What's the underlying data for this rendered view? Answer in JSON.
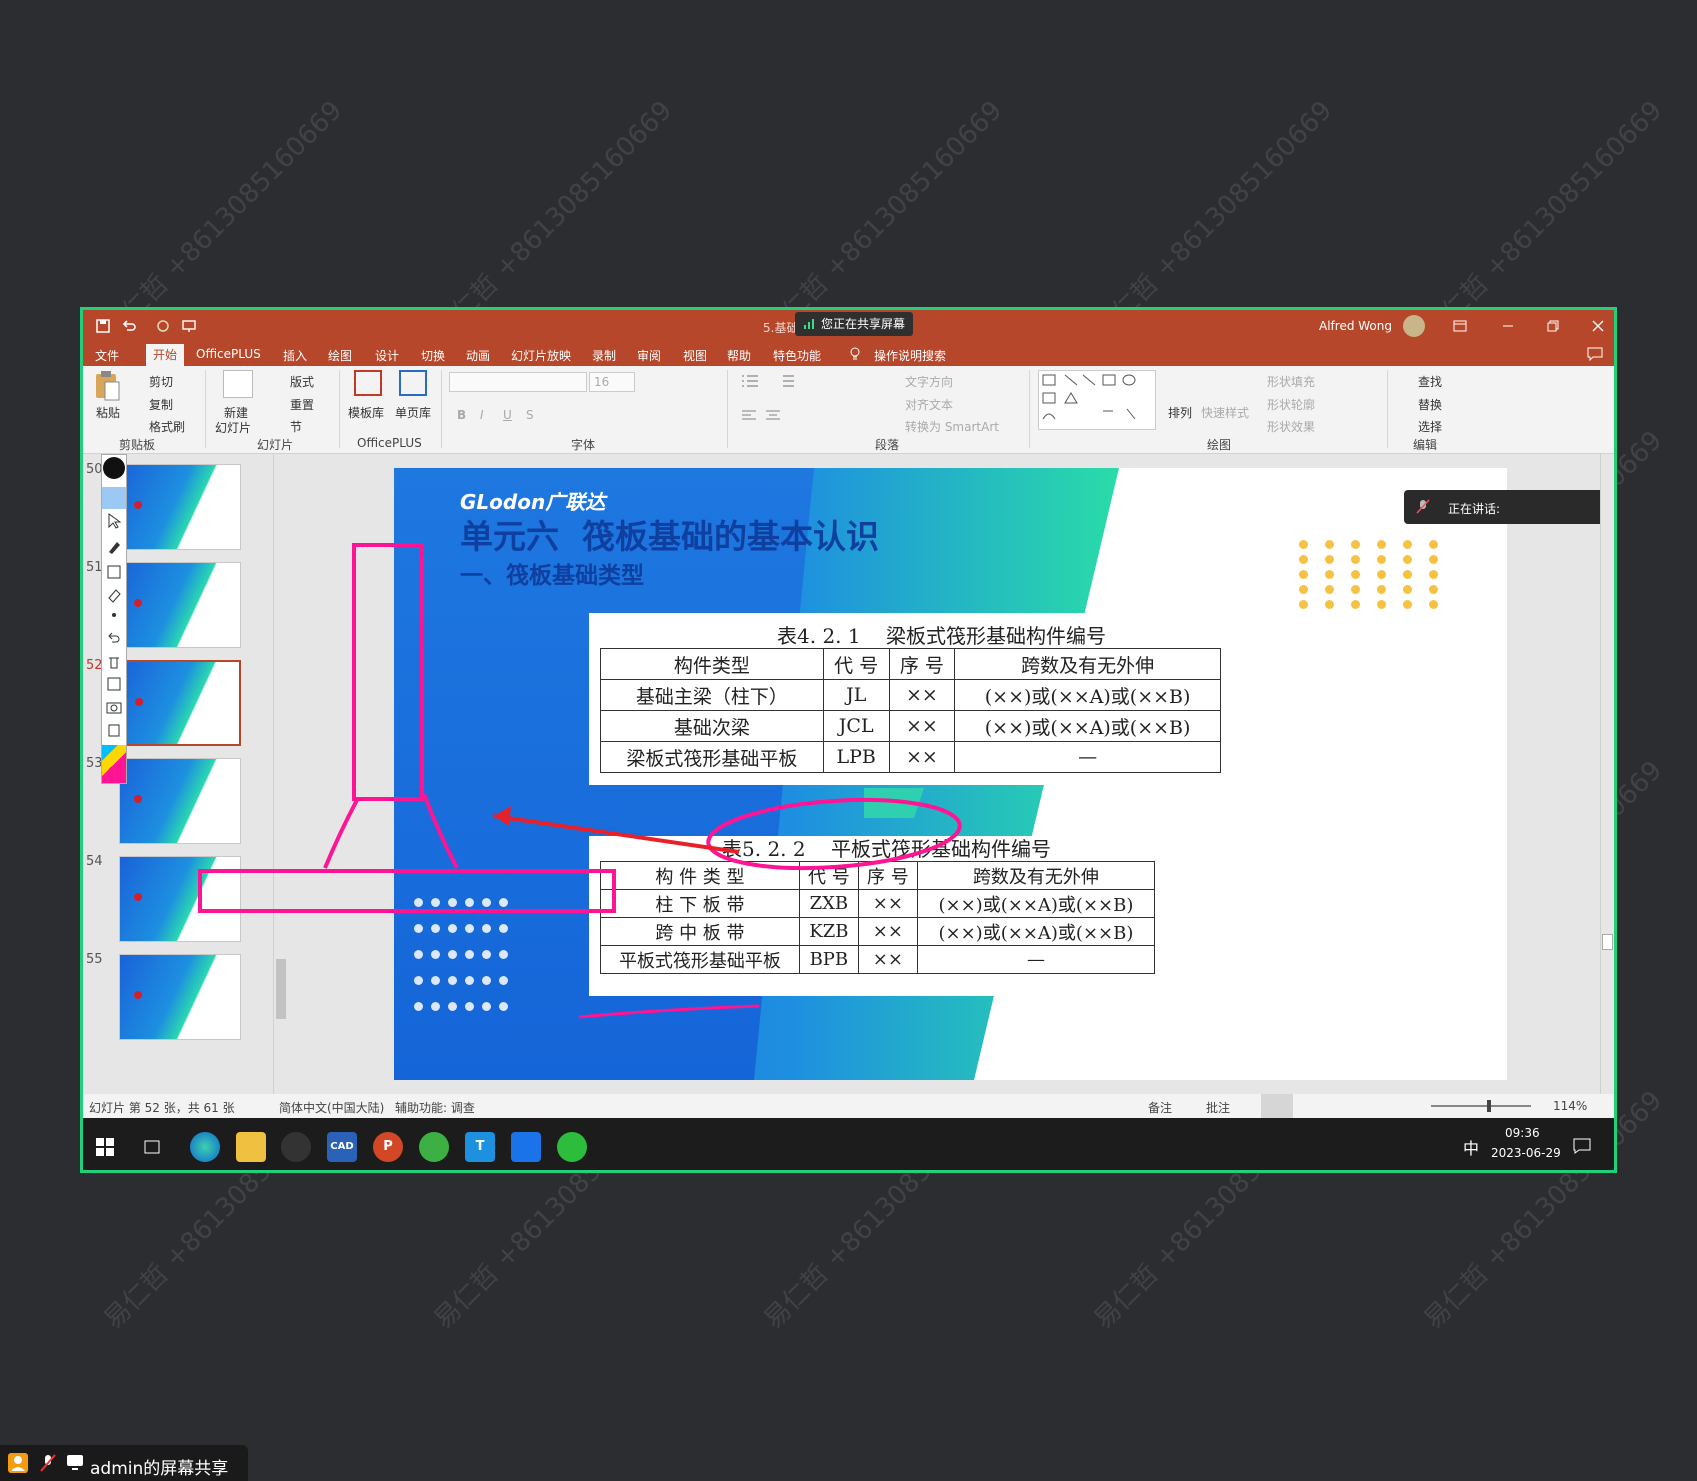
{
  "window": {
    "title": "5.基础...PowerPoint",
    "sharing_banner": "您正在共享屏幕",
    "user_name": "Alfred Wong"
  },
  "tabs": [
    "文件",
    "开始",
    "OfficePLUS",
    "插入",
    "绘图",
    "设计",
    "切换",
    "动画",
    "幻灯片放映",
    "录制",
    "审阅",
    "视图",
    "帮助",
    "特色功能",
    "操作说明搜索"
  ],
  "active_tab": "开始",
  "ribbon": {
    "clipboard": {
      "paste": "粘贴",
      "cut": "剪切",
      "copy": "复制",
      "format_painter": "格式刷",
      "group": "剪贴板"
    },
    "slides": {
      "new_slide": "新建",
      "new_slide2": "幻灯片",
      "layout": "版式",
      "reset": "重置",
      "section": "节",
      "group": "幻灯片"
    },
    "officeplus": {
      "template": "模板库",
      "single": "单页库",
      "group": "OfficePLUS"
    },
    "font": {
      "size": "16",
      "group": "字体"
    },
    "paragraph": {
      "text_dir": "文字方向",
      "align_text": "对齐文本",
      "smartart": "转换为 SmartArt",
      "group": "段落"
    },
    "drawing": {
      "arrange": "排列",
      "quick_styles": "快速样式",
      "fill": "形状填充",
      "outline": "形状轮廓",
      "effects": "形状效果",
      "group": "绘图"
    },
    "editing": {
      "find": "查找",
      "replace": "替换",
      "select": "选择",
      "group": "编辑"
    }
  },
  "thumbnails": [
    {
      "num": "50"
    },
    {
      "num": "51"
    },
    {
      "num": "52"
    },
    {
      "num": "53"
    },
    {
      "num": "54"
    },
    {
      "num": "55"
    }
  ],
  "slide": {
    "logo": "GLodon广联达",
    "title": "单元六  筏板基础的基本认识",
    "subtitle": "一、筏板基础类型",
    "table1": {
      "caption": "表4. 2. 1    梁板式筏形基础构件编号",
      "headers": [
        "构件类型",
        "代 号",
        "序 号",
        "跨数及有无外伸"
      ],
      "rows": [
        [
          "基础主梁（柱下）",
          "JL",
          "××",
          "(××)或(××A)或(××B)"
        ],
        [
          "基础次梁",
          "JCL",
          "××",
          "(××)或(××A)或(××B)"
        ],
        [
          "梁板式筏形基础平板",
          "LPB",
          "××",
          "—"
        ]
      ]
    },
    "table2": {
      "caption": "表5. 2. 2    平板式筏形基础构件编号",
      "headers": [
        "构 件 类 型",
        "代 号",
        "序 号",
        "跨数及有无外伸"
      ],
      "rows": [
        [
          "柱 下 板 带",
          "ZXB",
          "××",
          "(××)或(××A)或(××B)"
        ],
        [
          "跨 中 板 带",
          "KZB",
          "××",
          "(××)或(××A)或(××B)"
        ],
        [
          "平板式筏形基础平板",
          "BPB",
          "××",
          "—"
        ]
      ]
    }
  },
  "speaking_label": "正在讲话:",
  "status": {
    "slide_info": "幻灯片 第 52 张，共 61 张",
    "language": "简体中文(中国大陆)",
    "accessibility": "辅助功能: 调查",
    "notes": "备注",
    "comments": "批注",
    "zoom": "114%"
  },
  "taskbar": {
    "ime": "中",
    "time": "09:36",
    "date": "2023-06-29"
  },
  "screen_share_label": "admin的屏幕共享",
  "watermark": "易仁哲 +8613085160669",
  "colors": {
    "accent": "#b7472a",
    "frame": "#21d07a",
    "annotation": "#ff1493",
    "arrow": "#e8202a"
  }
}
